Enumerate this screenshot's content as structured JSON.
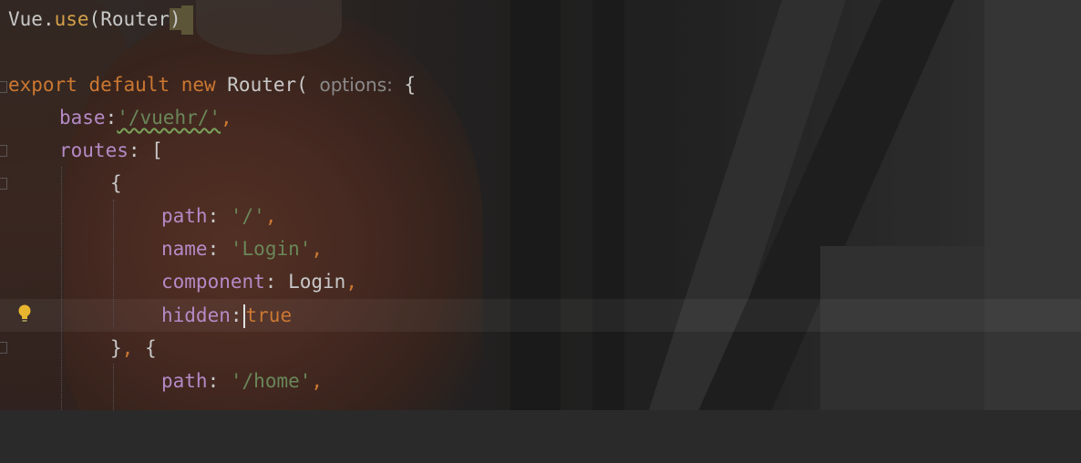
{
  "editor": {
    "lines": {
      "l1": {
        "ident": "Vue",
        "dot": ".",
        "fn": "use",
        "open": "(",
        "arg": "Router",
        "close": ")"
      },
      "l3": {
        "kw1": "export",
        "kw2": "default",
        "kw3": "new",
        "cls": "Router",
        "open": "(",
        "hint": "options:",
        "brace": "{"
      },
      "l4": {
        "key": "base",
        "colon": ":",
        "value": "'/vuehr/'",
        "comma": ","
      },
      "l5": {
        "key": "routes",
        "colon": ":",
        "bracket": "["
      },
      "l6": {
        "brace": "{"
      },
      "l7": {
        "key": "path",
        "colon": ":",
        "value": "'/'",
        "comma": ","
      },
      "l8": {
        "key": "name",
        "colon": ":",
        "value": "'Login'",
        "comma": ","
      },
      "l9": {
        "key": "component",
        "colon": ":",
        "value": "Login",
        "comma": ","
      },
      "l10": {
        "key": "hidden",
        "colon": ":",
        "value": "true"
      },
      "l11": {
        "close": "}",
        "comma": ",",
        "open": "{"
      },
      "l12": {
        "key": "path",
        "colon": ":",
        "value": "'/home'",
        "comma": ","
      }
    },
    "colors": {
      "keyword": "#cc7832",
      "property": "#b58ac6",
      "string": "#6a8759",
      "function": "#d4a04a",
      "text": "#c8c8c8",
      "hint": "#8a8a8a"
    },
    "gutter_icon": "lightbulb-icon"
  }
}
